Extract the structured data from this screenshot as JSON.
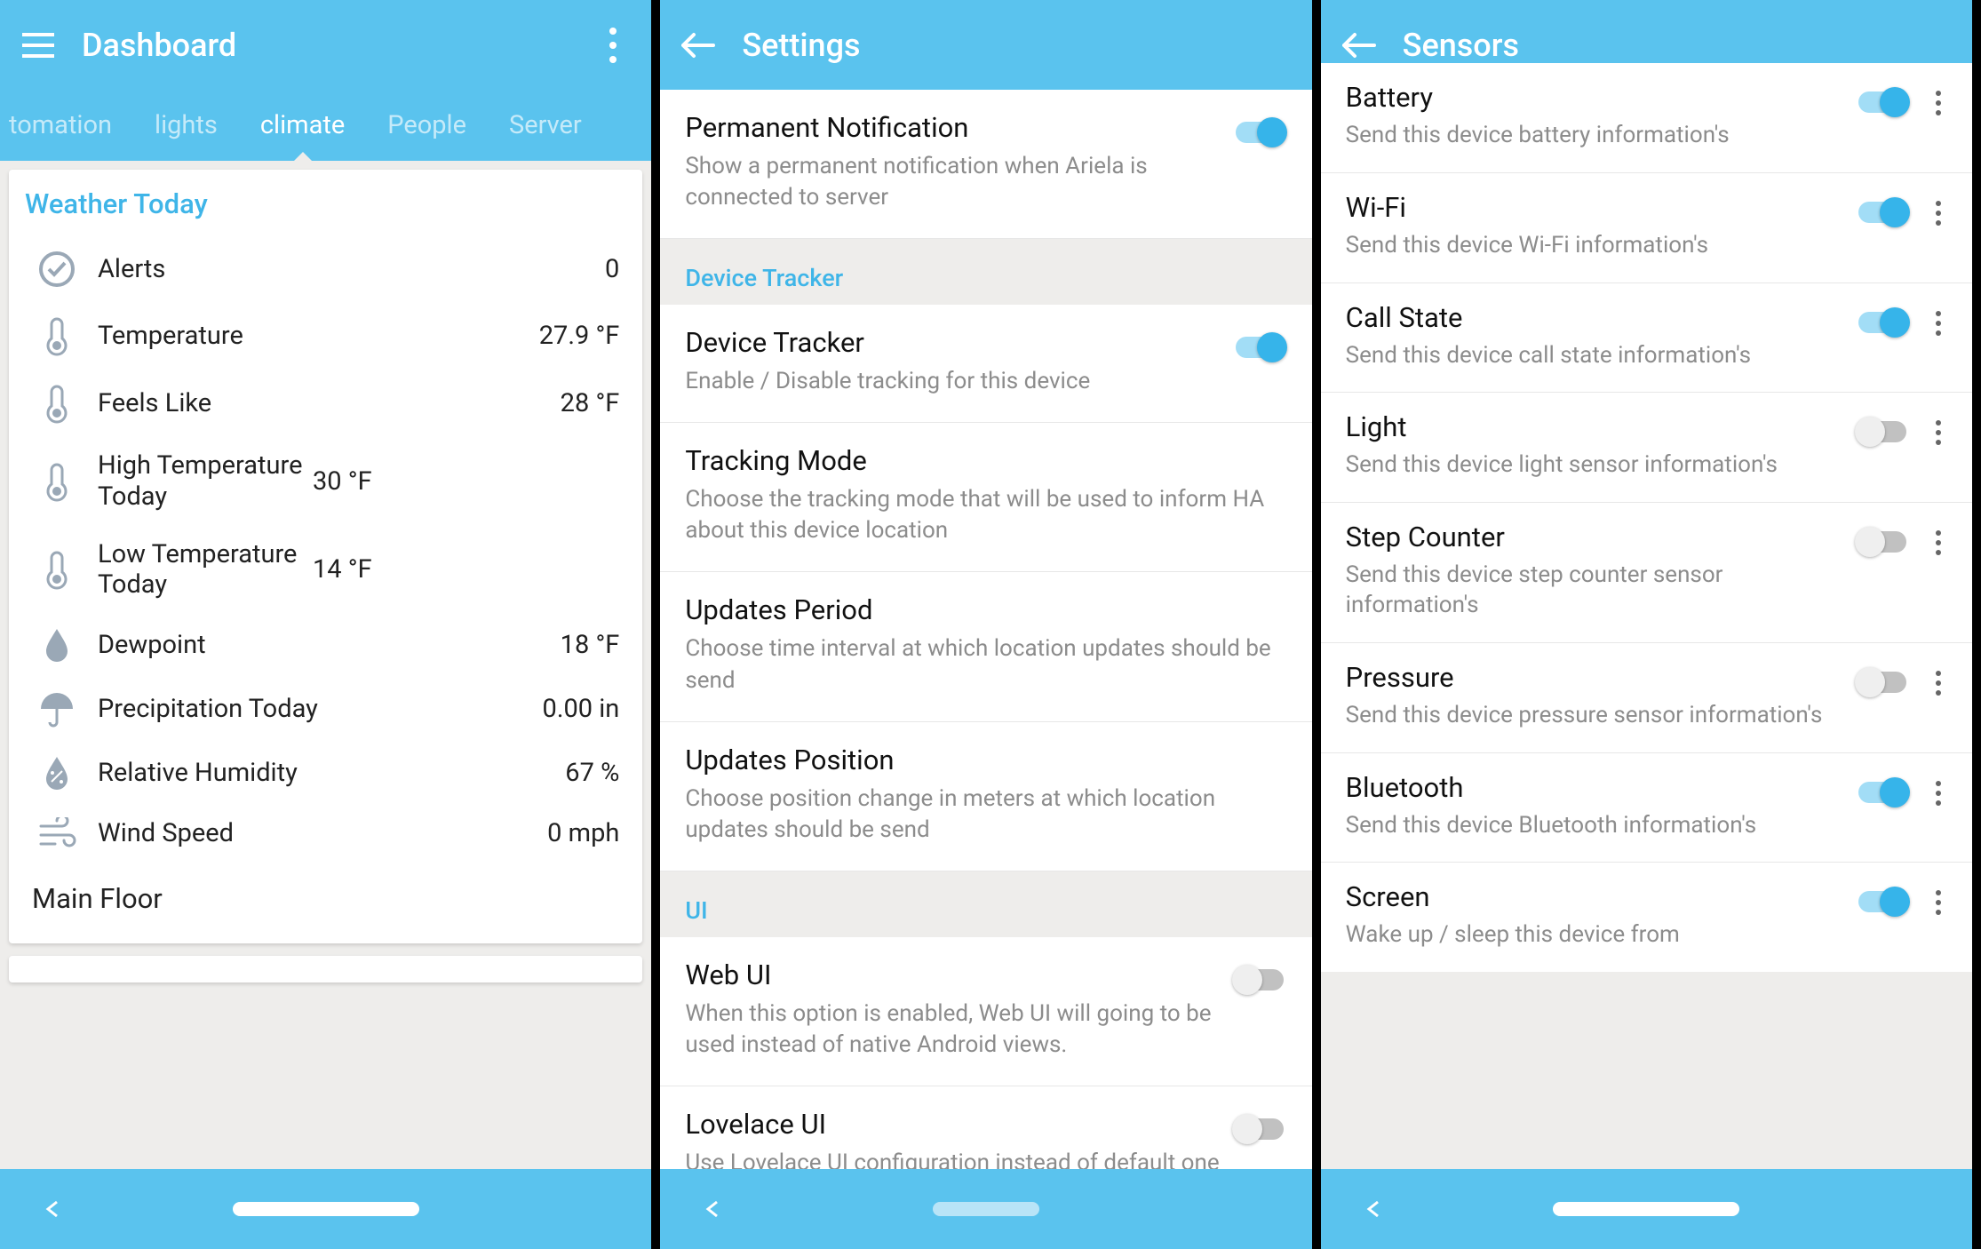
{
  "screen1": {
    "title": "Dashboard",
    "tabs": [
      "tomation",
      "lights",
      "climate",
      "People",
      "Server"
    ],
    "active_tab": "climate",
    "card_title": "Weather Today",
    "items": [
      {
        "label": "Alerts",
        "value": "0"
      },
      {
        "label": "Temperature",
        "value": "27.9 °F"
      },
      {
        "label": "Feels Like",
        "value": "28 °F"
      },
      {
        "label": "High Temperature Today",
        "value": "30 °F"
      },
      {
        "label": "Low Temperature Today",
        "value": "14 °F"
      },
      {
        "label": "Dewpoint",
        "value": "18 °F"
      },
      {
        "label": "Precipitation Today",
        "value": "0.00 in"
      },
      {
        "label": "Relative Humidity",
        "value": "67 %"
      },
      {
        "label": "Wind Speed",
        "value": "0 mph"
      }
    ],
    "footer_label": "Main Floor"
  },
  "screen2": {
    "title": "Settings",
    "rows": [
      {
        "title": "Permanent Notification",
        "sub": "Show a permanent notification when Ariela is connected to server",
        "toggle": "on"
      },
      {
        "header": "Device Tracker"
      },
      {
        "title": "Device Tracker",
        "sub": "Enable / Disable tracking for this device",
        "toggle": "on"
      },
      {
        "title": "Tracking Mode",
        "sub": "Choose the tracking mode that will be used to inform HA about this device location"
      },
      {
        "title": "Updates Period",
        "sub": "Choose time interval at which location updates should be send"
      },
      {
        "title": "Updates Position",
        "sub": "Choose position change in meters at which location updates should be send"
      },
      {
        "header": "UI"
      },
      {
        "title": "Web UI",
        "sub": "When this option is enabled, Web UI will going to be used instead of native Android views.",
        "toggle": "off"
      },
      {
        "title": "Lovelace UI",
        "sub": "Use Lovelace UI configuration instead of default one",
        "toggle": "off"
      }
    ]
  },
  "screen3": {
    "title": "Sensors",
    "rows": [
      {
        "title": "Battery",
        "sub": "Send this device battery information's",
        "toggle": "on"
      },
      {
        "title": "Wi-Fi",
        "sub": "Send this device Wi-Fi information's",
        "toggle": "on"
      },
      {
        "title": "Call State",
        "sub": "Send this device call state information's",
        "toggle": "on"
      },
      {
        "title": "Light",
        "sub": "Send this device light sensor information's",
        "toggle": "off"
      },
      {
        "title": "Step Counter",
        "sub": "Send this device step counter sensor information's",
        "toggle": "off"
      },
      {
        "title": "Pressure",
        "sub": "Send this device pressure sensor information's",
        "toggle": "off"
      },
      {
        "title": "Bluetooth",
        "sub": "Send this device Bluetooth information's",
        "toggle": "on"
      },
      {
        "title": "Screen",
        "sub": "Wake up / sleep this device from",
        "toggle": "on"
      }
    ]
  }
}
